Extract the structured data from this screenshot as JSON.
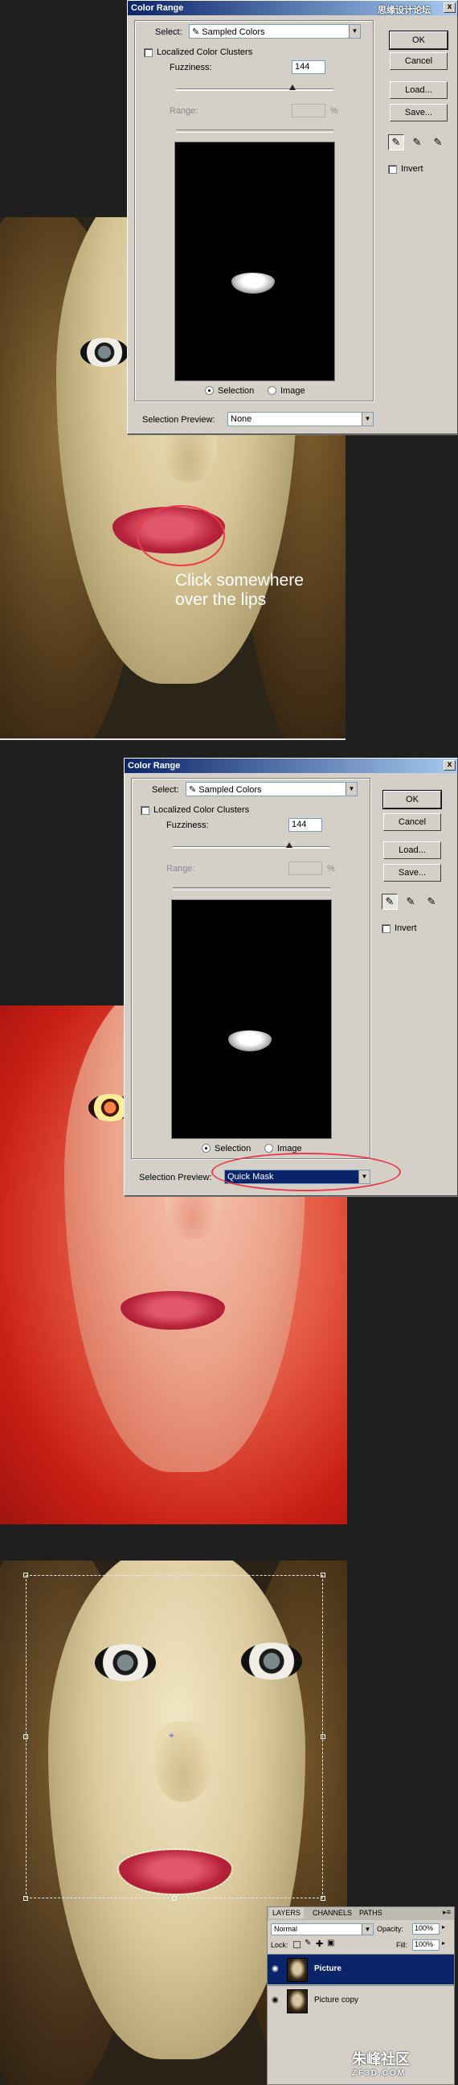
{
  "dialog1": {
    "title": "Color Range",
    "select_label": "Select:",
    "select_value": "Sampled Colors",
    "localized_label": "Localized Color Clusters",
    "fuzziness_label": "Fuzziness:",
    "fuzziness_value": "144",
    "range_label": "Range:",
    "range_unit": "%",
    "selection_radio": "Selection",
    "image_radio": "Image",
    "preview_label": "Selection Preview:",
    "preview_value": "None",
    "ok": "OK",
    "cancel": "Cancel",
    "load": "Load...",
    "save": "Save...",
    "invert": "Invert",
    "close": "x"
  },
  "dialog2": {
    "title": "Color Range",
    "select_label": "Select:",
    "select_value": "Sampled Colors",
    "localized_label": "Localized Color Clusters",
    "fuzziness_label": "Fuzziness:",
    "fuzziness_value": "144",
    "range_label": "Range:",
    "range_unit": "%",
    "selection_radio": "Selection",
    "image_radio": "Image",
    "preview_label": "Selection Preview:",
    "preview_value": "Quick Mask",
    "ok": "OK",
    "cancel": "Cancel",
    "load": "Load...",
    "save": "Save...",
    "invert": "Invert",
    "close": "x"
  },
  "annotation": {
    "line1": "Click somewhere",
    "line2": "over the lips"
  },
  "layers_panel": {
    "tabs": [
      "LAYERS",
      "CHANNELS",
      "PATHS"
    ],
    "blend_mode": "Normal",
    "opacity_label": "Opacity:",
    "opacity_value": "100%",
    "lock_label": "Lock:",
    "fill_label": "Fill:",
    "fill_value": "100%",
    "layers": [
      "Picture",
      "Picture copy"
    ]
  },
  "watermark": {
    "top": "思缘设计论坛",
    "bottom_cn": "朱峰社区",
    "bottom_en": "ZF3D.COM"
  },
  "colors": {
    "dialog_bg": "#d4d0c8",
    "title_start": "#0a246a",
    "title_end": "#a6caf0",
    "quick_mask_red": "#e02a1e",
    "annotation_ring": "#e83a48"
  },
  "icons": [
    "eyedropper-icon",
    "eyedropper-plus-icon",
    "eyedropper-minus-icon",
    "eye-icon",
    "chevron-down-icon"
  ]
}
